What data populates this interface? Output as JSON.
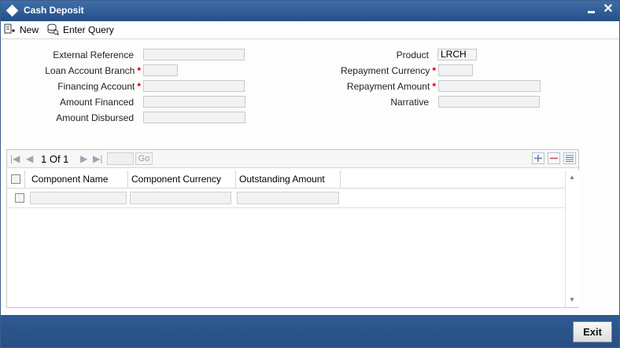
{
  "window": {
    "title": "Cash Deposit"
  },
  "toolbar": {
    "new_label": "New",
    "enter_query_label": "Enter Query"
  },
  "form": {
    "external_reference": {
      "label": "External Reference",
      "value": ""
    },
    "loan_account_branch": {
      "label": "Loan Account Branch",
      "value": ""
    },
    "financing_account": {
      "label": "Financing Account",
      "value": ""
    },
    "amount_financed": {
      "label": "Amount Financed",
      "value": ""
    },
    "amount_disbursed": {
      "label": "Amount Disbursed",
      "value": ""
    },
    "product": {
      "label": "Product",
      "value": "LRCH"
    },
    "repayment_currency": {
      "label": "Repayment Currency",
      "value": ""
    },
    "repayment_amount": {
      "label": "Repayment Amount",
      "value": ""
    },
    "narrative": {
      "label": "Narrative",
      "value": ""
    },
    "required_marker": "*"
  },
  "grid": {
    "page_info": "1 Of 1",
    "go_label": "Go",
    "columns": [
      "Component Name",
      "Component Currency",
      "Outstanding Amount"
    ]
  },
  "footer": {
    "exit_label": "Exit"
  }
}
